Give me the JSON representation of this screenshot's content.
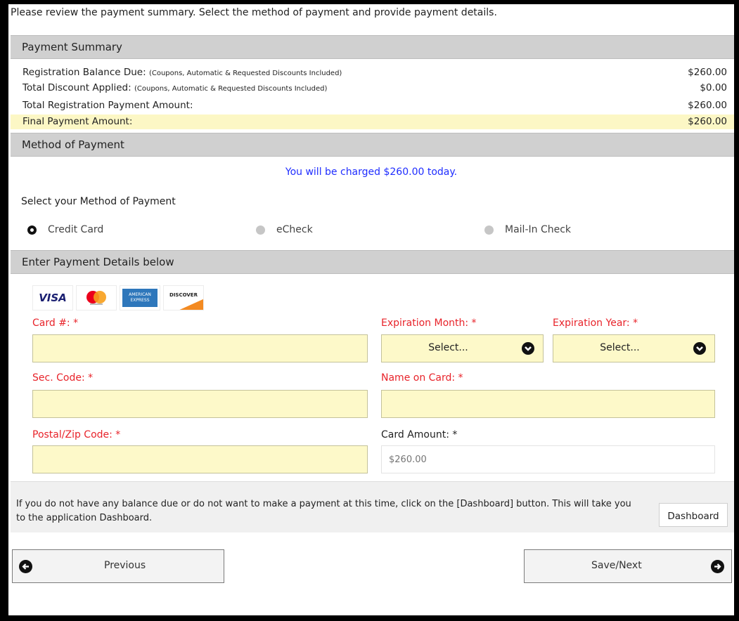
{
  "intro": "Please review the payment summary. Select the method of payment and provide payment details.",
  "summary": {
    "header": "Payment Summary",
    "rows": [
      {
        "label": "Registration Balance Due:",
        "note": "(Coupons, Automatic & Requested Discounts Included)",
        "amount": "$260.00"
      },
      {
        "label": "Total Discount Applied:",
        "note": "(Coupons, Automatic & Requested Discounts Included)",
        "amount": "$0.00"
      },
      {
        "label": "Total Registration Payment Amount:",
        "note": "",
        "amount": "$260.00"
      },
      {
        "label": "Final Payment Amount:",
        "note": "",
        "amount": "$260.00"
      }
    ]
  },
  "method": {
    "header": "Method of Payment",
    "charged_text": "You will be charged $260.00 today.",
    "select_label": "Select your Method of Payment",
    "options": [
      {
        "label": "Credit Card",
        "selected": true
      },
      {
        "label": "eCheck",
        "selected": false
      },
      {
        "label": "Mail-In Check",
        "selected": false
      }
    ]
  },
  "details": {
    "header": "Enter Payment Details below",
    "card_logos": {
      "visa": "VISA",
      "amex_top": "AMERICAN",
      "amex_bottom": "EXPRESS",
      "discover": "DISCOVER"
    },
    "card_number_label": "Card #: *",
    "exp_month_label": "Expiration Month: *",
    "exp_year_label": "Expiration Year: *",
    "exp_month_value": "Select...",
    "exp_year_value": "Select...",
    "sec_code_label": "Sec. Code: *",
    "name_label": "Name on Card: *",
    "zip_label": "Postal/Zip Code: *",
    "card_amount_label": "Card Amount: *",
    "card_amount_placeholder": "$260.00"
  },
  "info": {
    "message": "If you do not have any balance due or do not want to make a payment at this time, click on the [Dashboard] button. This will take you to the application Dashboard.",
    "dashboard_label": "Dashboard"
  },
  "nav": {
    "previous_label": "Previous",
    "next_label": "Save/Next"
  },
  "colors": {
    "required_label": "#e8232a",
    "charged_text": "#1f2dff",
    "highlight_row": "#fcf7c5",
    "input_bg": "#fdf9c9",
    "section_header": "#d0d0d0"
  }
}
